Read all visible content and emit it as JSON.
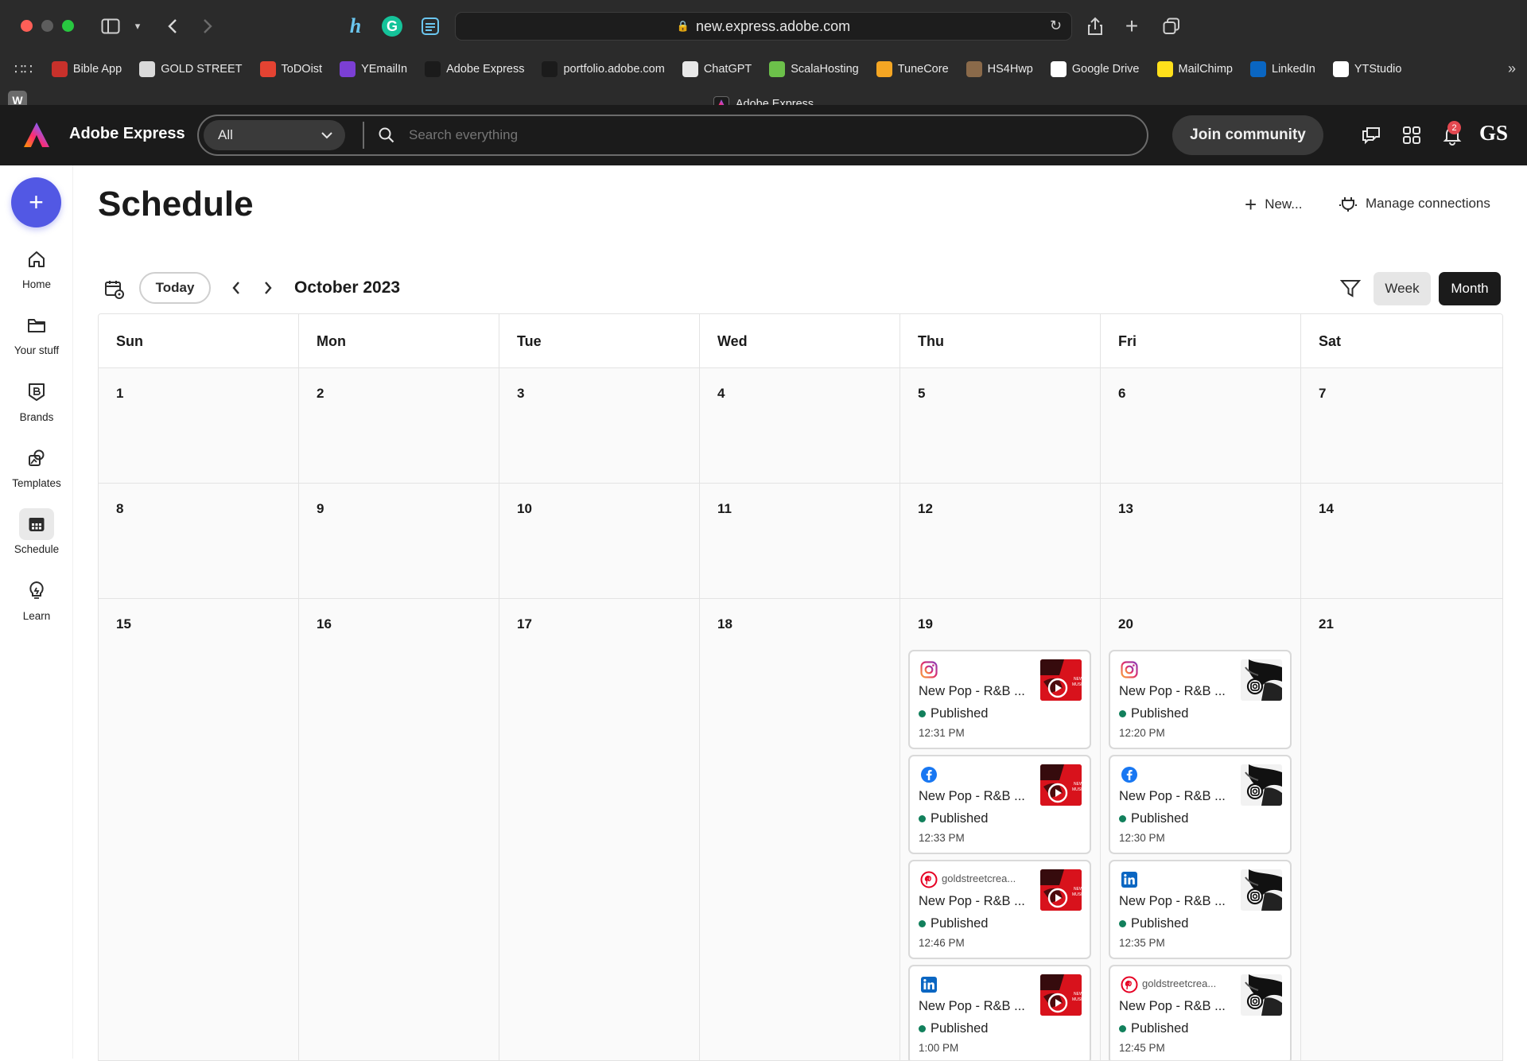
{
  "browser": {
    "url": "new.express.adobe.com",
    "tab_title": "Adobe Express",
    "w_badge": "W",
    "bookmarks": [
      {
        "label": "Bible App",
        "color": "#c8312b",
        "icon": "bible-icon"
      },
      {
        "label": "GOLD STREET",
        "color": "#d9d9d9",
        "icon": "gold-street-icon"
      },
      {
        "label": "ToDOist",
        "color": "#e44332",
        "icon": "todoist-icon"
      },
      {
        "label": "YEmailIn",
        "color": "#7b3fd4",
        "icon": "email-icon"
      },
      {
        "label": "Adobe Express",
        "color": "#1b1b1b",
        "icon": "adobe-express-icon"
      },
      {
        "label": "portfolio.adobe.com",
        "color": "#1b1b1b",
        "icon": "portfolio-icon"
      },
      {
        "label": "ChatGPT",
        "color": "#e9e9e9",
        "icon": "chatgpt-icon"
      },
      {
        "label": "ScalaHosting",
        "color": "#6cc04a",
        "icon": "scalahosting-icon"
      },
      {
        "label": "TuneCore",
        "color": "#f5a623",
        "icon": "tunecore-icon"
      },
      {
        "label": "HS4Hwp",
        "color": "#8a6a4a",
        "icon": "hs4hwp-icon"
      },
      {
        "label": "Google Drive",
        "color": "#ffffff",
        "icon": "google-icon"
      },
      {
        "label": "MailChimp",
        "color": "#ffe01b",
        "icon": "mailchimp-icon"
      },
      {
        "label": "LinkedIn",
        "color": "#0a66c2",
        "icon": "linkedin-icon"
      },
      {
        "label": "YTStudio",
        "color": "#ffffff",
        "icon": "google-icon"
      }
    ]
  },
  "header": {
    "app_name": "Adobe Express",
    "scope": "All",
    "search_placeholder": "Search everything",
    "join_label": "Join community",
    "notif_count": "2",
    "avatar": "GS"
  },
  "nav": {
    "items": [
      {
        "label": "Home",
        "icon": "home-icon"
      },
      {
        "label": "Your stuff",
        "icon": "folder-icon"
      },
      {
        "label": "Brands",
        "icon": "brand-icon"
      },
      {
        "label": "Templates",
        "icon": "templates-icon"
      },
      {
        "label": "Schedule",
        "icon": "calendar-icon",
        "active": true
      },
      {
        "label": "Learn",
        "icon": "lightbulb-icon"
      }
    ]
  },
  "page": {
    "title": "Schedule",
    "new_label": "New...",
    "manage_label": "Manage connections",
    "today_label": "Today",
    "month_label": "October 2023",
    "week_label": "Week",
    "month_view_label": "Month"
  },
  "calendar": {
    "days": [
      "Sun",
      "Mon",
      "Tue",
      "Wed",
      "Thu",
      "Fri",
      "Sat"
    ],
    "weeks": [
      [
        "1",
        "2",
        "3",
        "4",
        "5",
        "6",
        "7"
      ],
      [
        "8",
        "9",
        "10",
        "11",
        "12",
        "13",
        "14"
      ],
      [
        "15",
        "16",
        "17",
        "18",
        "19",
        "20",
        "21"
      ]
    ],
    "posts": {
      "thu": [
        {
          "network": "instagram",
          "title": "New Pop - R&B ...",
          "status": "Published",
          "time": "12:31 PM",
          "thumb": "red"
        },
        {
          "network": "facebook",
          "title": "New Pop - R&B ...",
          "status": "Published",
          "time": "12:33 PM",
          "thumb": "red"
        },
        {
          "network": "pinterest",
          "handle": "goldstreetcrea...",
          "title": "New Pop - R&B ...",
          "status": "Published",
          "time": "12:46 PM",
          "thumb": "red"
        },
        {
          "network": "linkedin",
          "title": "New Pop - R&B ...",
          "status": "Published",
          "time": "1:00 PM",
          "thumb": "red"
        }
      ],
      "fri": [
        {
          "network": "instagram",
          "title": "New Pop - R&B ...",
          "status": "Published",
          "time": "12:20 PM",
          "thumb": "bw"
        },
        {
          "network": "facebook",
          "title": "New Pop - R&B ...",
          "status": "Published",
          "time": "12:30 PM",
          "thumb": "bw"
        },
        {
          "network": "linkedin",
          "title": "New Pop - R&B ...",
          "status": "Published",
          "time": "12:35 PM",
          "thumb": "bw"
        },
        {
          "network": "pinterest",
          "handle": "goldstreetcrea...",
          "title": "New Pop - R&B ...",
          "status": "Published",
          "time": "12:45 PM",
          "thumb": "bw"
        }
      ]
    }
  },
  "colors": {
    "fab": "#5258e4",
    "published_dot": "#12805c",
    "notif": "#e34850"
  }
}
